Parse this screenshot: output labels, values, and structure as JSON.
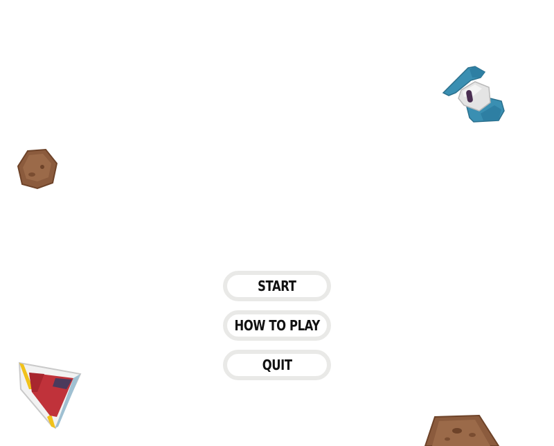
{
  "menu": {
    "start_label": "START",
    "how_to_play_label": "HOW TO PLAY",
    "quit_label": "QUIT"
  },
  "sprites": {
    "enemy_ship_icon": "enemy-ship-icon",
    "player_ship_icon": "player-ship-icon",
    "asteroid_small_icon": "asteroid-small-icon",
    "asteroid_large_icon": "asteroid-large-icon"
  },
  "colors": {
    "background": "#ffffff",
    "button_border": "#e9e9e7",
    "button_text": "#111111",
    "asteroid_brown": "#8a5a3c",
    "enemy_blue": "#2e86a8",
    "player_red": "#c0323a"
  }
}
